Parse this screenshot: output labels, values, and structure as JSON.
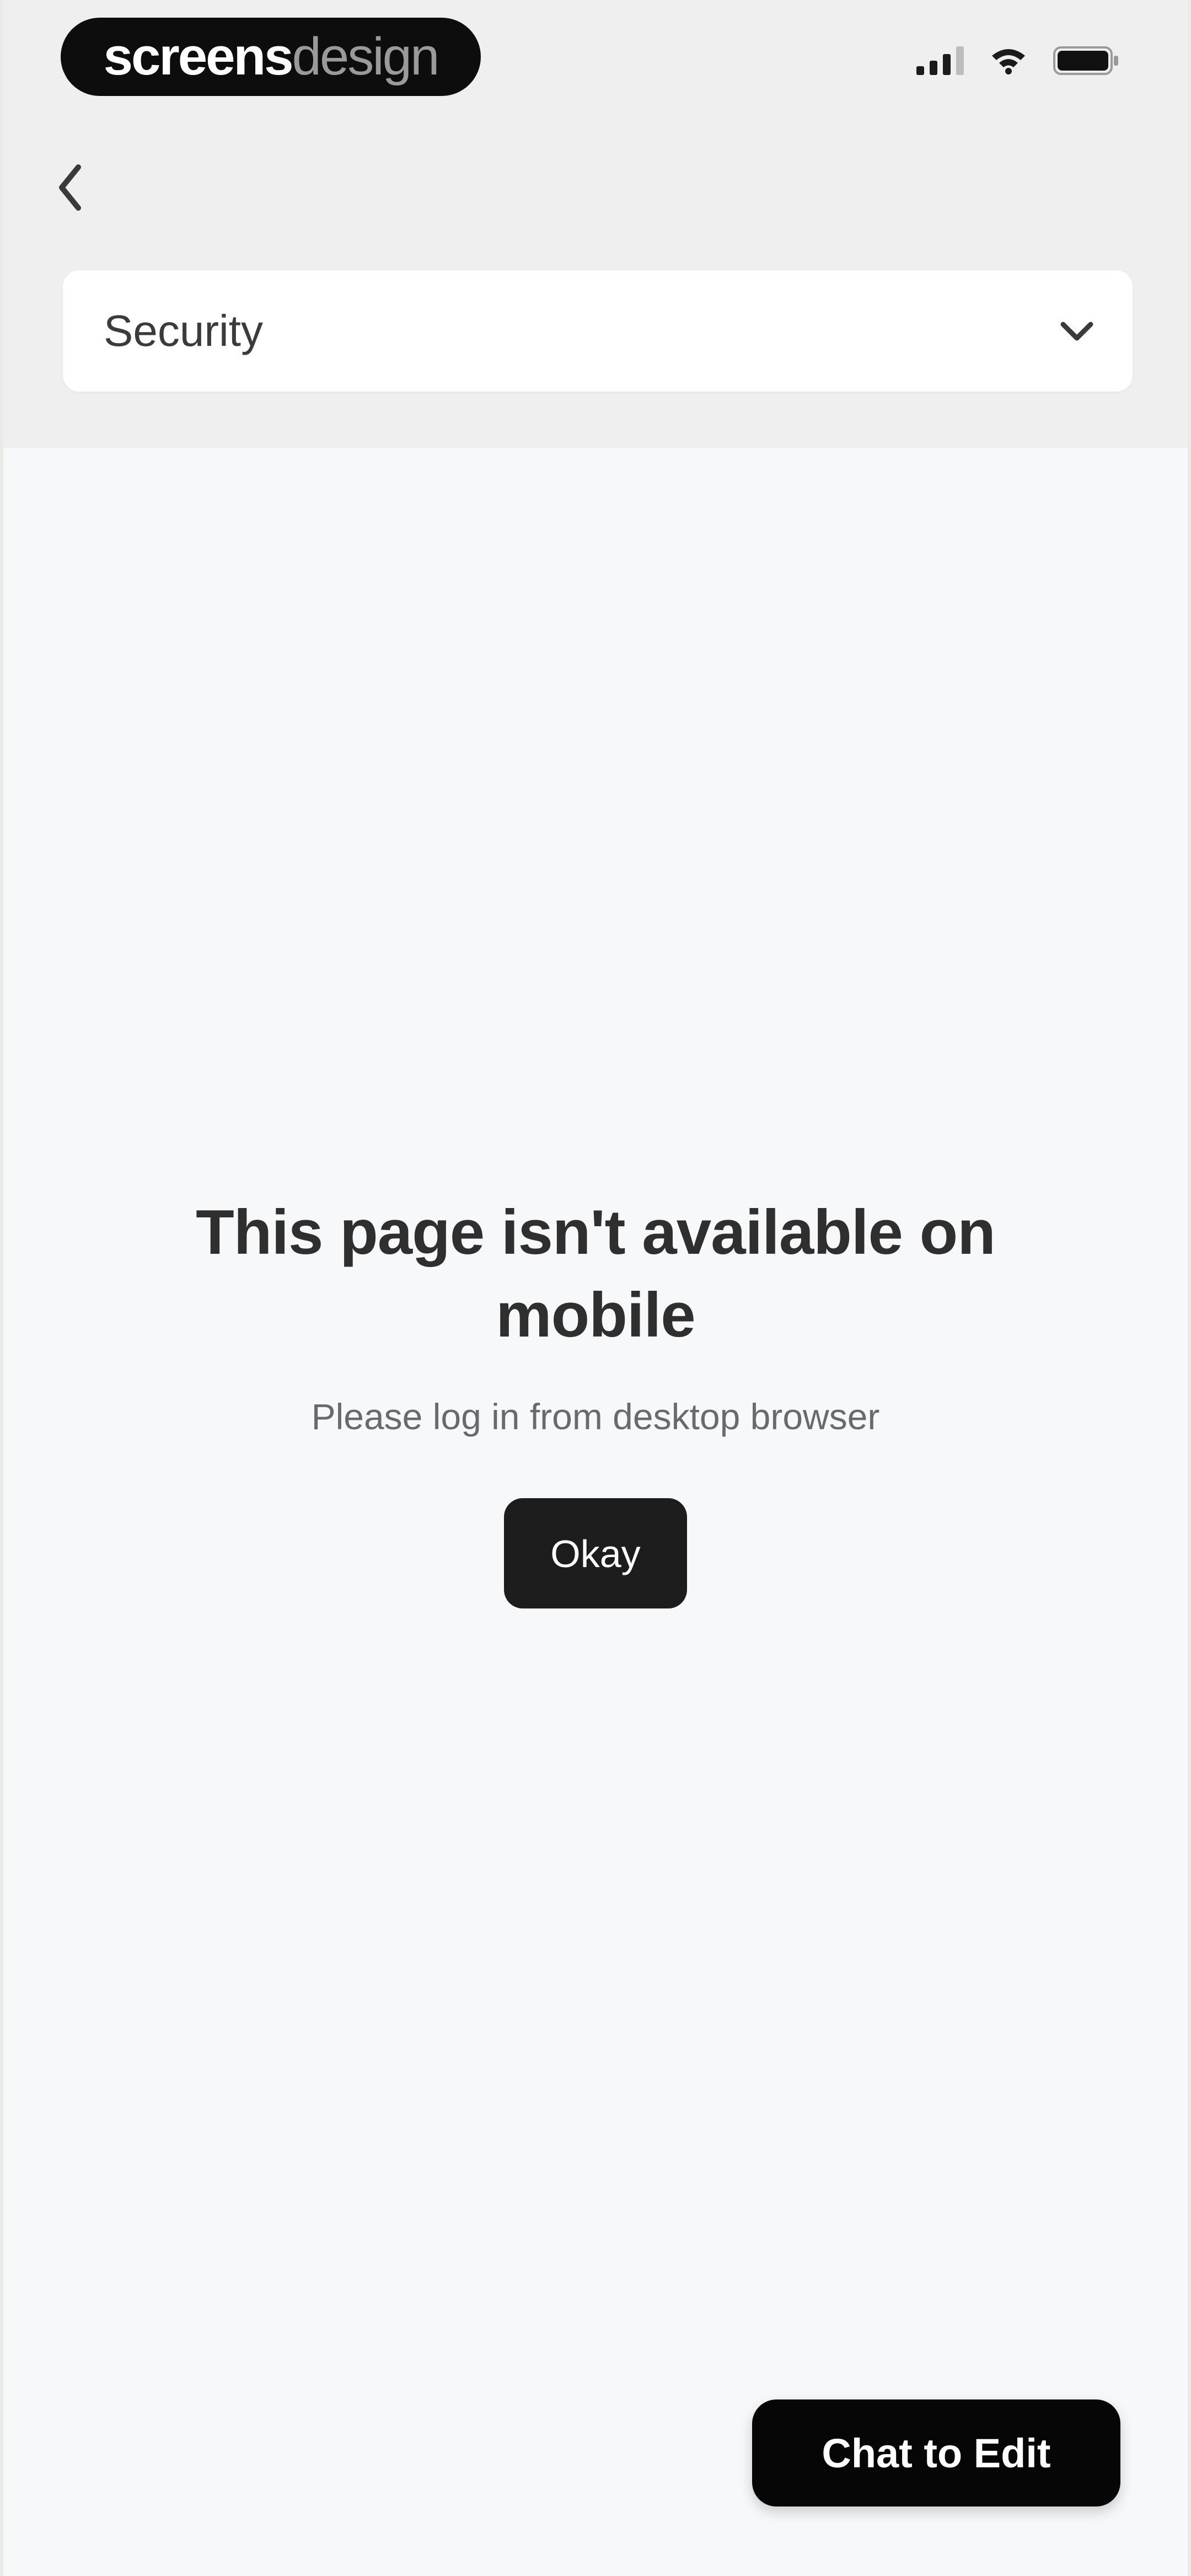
{
  "brand": {
    "part_bold": "screens",
    "part_light": "design"
  },
  "status_bar": {
    "icons": [
      "signal-icon",
      "wifi-icon",
      "battery-icon"
    ]
  },
  "header": {
    "back_icon": "chevron-left-icon"
  },
  "section_select": {
    "value": "Security",
    "icon": "chevron-down-icon"
  },
  "message": {
    "title": "This page isn't available on mobile",
    "subtitle": "Please log in from desktop browser",
    "button_label": "Okay"
  },
  "chat_button": {
    "label": "Chat to Edit"
  },
  "colors": {
    "background": "#f7f8fa",
    "header_background": "#efefef",
    "button_dark": "#1d1d1d",
    "text_primary": "#2f2f2f",
    "text_secondary": "#6a6a6a"
  }
}
